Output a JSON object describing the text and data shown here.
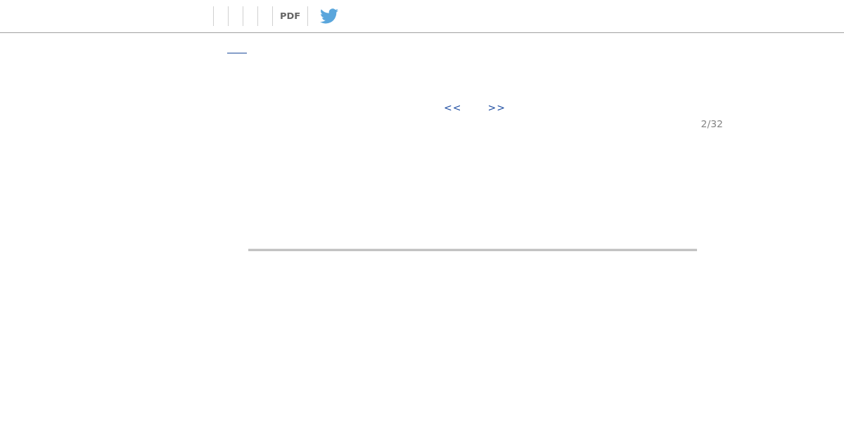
{
  "toolbar": {
    "pdf_label": "PDF"
  },
  "pager": {
    "previous": "<<",
    "next": ">>",
    "page": "2/32"
  }
}
